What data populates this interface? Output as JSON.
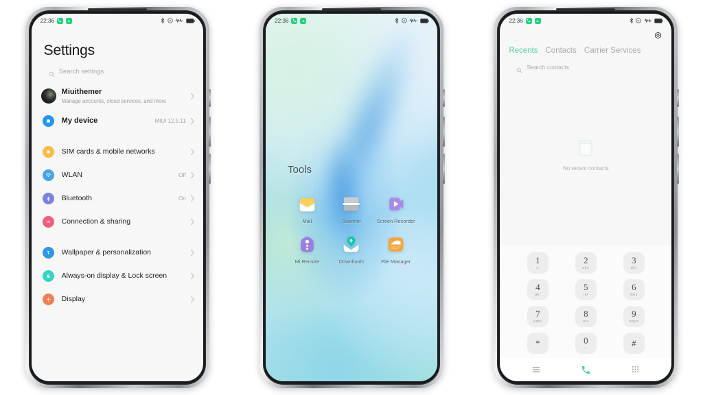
{
  "statusbar": {
    "time": "22:36",
    "left_icons": [
      "phone-badge-icon",
      "download-badge-icon"
    ],
    "right_icons": [
      "bluetooth-icon",
      "dnd-icon",
      "signal-wave-icon",
      "battery-icon"
    ]
  },
  "phone1": {
    "app": "Settings",
    "title": "Settings",
    "search_placeholder": "Search settings",
    "groups": [
      {
        "items": [
          {
            "icon": "account-avatar",
            "label": "Miuithemer",
            "sub": "Manage accounts, cloud services, and more",
            "value": "",
            "color": "#171a18",
            "bold": true
          },
          {
            "icon": "device-icon",
            "label": "My device",
            "sub": "",
            "value": "MIUI 12.5.11",
            "color": "#2196f3",
            "bold": true
          }
        ]
      },
      {
        "items": [
          {
            "icon": "sim-card-icon",
            "label": "SIM cards & mobile networks",
            "sub": "",
            "value": "",
            "color": "#f5bd42",
            "bold": false
          },
          {
            "icon": "wifi-icon",
            "label": "WLAN",
            "sub": "",
            "value": "Off",
            "color": "#4aa3e8",
            "bold": false
          },
          {
            "icon": "bluetooth-icon",
            "label": "Bluetooth",
            "sub": "",
            "value": "On",
            "color": "#7b82e0",
            "bold": false
          },
          {
            "icon": "connection-sharing-icon",
            "label": "Connection & sharing",
            "sub": "",
            "value": "",
            "color": "#ef5f7e",
            "bold": false
          }
        ]
      },
      {
        "items": [
          {
            "icon": "wallpaper-icon",
            "label": "Wallpaper & personalization",
            "sub": "",
            "value": "",
            "color": "#2f97e8",
            "bold": false
          },
          {
            "icon": "lock-icon",
            "label": "Always-on display & Lock screen",
            "sub": "",
            "value": "",
            "color": "#3ad3c2",
            "bold": false
          },
          {
            "icon": "display-icon",
            "label": "Display",
            "sub": "",
            "value": "",
            "color": "#ef8055",
            "bold": false
          }
        ]
      }
    ]
  },
  "phone2": {
    "app": "Home screen folder",
    "folder_title": "Tools",
    "apps": [
      {
        "name": "Mail",
        "icon": "mail-icon"
      },
      {
        "name": "Scanner",
        "icon": "scanner-icon"
      },
      {
        "name": "Screen Recorder",
        "icon": "screen-recorder-icon"
      },
      {
        "name": "Mi Remote",
        "icon": "mi-remote-icon"
      },
      {
        "name": "Downloads",
        "icon": "downloads-icon"
      },
      {
        "name": "File Manager",
        "icon": "file-manager-icon"
      }
    ]
  },
  "phone3": {
    "app": "Phone",
    "settings_icon": "gear-icon",
    "tabs": [
      {
        "label": "Recents",
        "active": true
      },
      {
        "label": "Contacts",
        "active": false
      },
      {
        "label": "Carrier Services",
        "active": false
      }
    ],
    "search_placeholder": "Search contacts",
    "empty_state": {
      "icon": "no-contacts-icon",
      "text": "No recent contacts"
    },
    "keypad": [
      {
        "num": "1",
        "sub": "∞"
      },
      {
        "num": "2",
        "sub": "abc"
      },
      {
        "num": "3",
        "sub": "def"
      },
      {
        "num": "4",
        "sub": "ghi"
      },
      {
        "num": "5",
        "sub": "jkl"
      },
      {
        "num": "6",
        "sub": "mno"
      },
      {
        "num": "7",
        "sub": "pqrs"
      },
      {
        "num": "8",
        "sub": "tuv"
      },
      {
        "num": "9",
        "sub": "wxyz"
      },
      {
        "num": "*",
        "sub": ""
      },
      {
        "num": "0",
        "sub": "+"
      },
      {
        "num": "#",
        "sub": ""
      }
    ],
    "bottom_bar": [
      {
        "icon": "menu-icon"
      },
      {
        "icon": "call-icon"
      },
      {
        "icon": "dialpad-icon"
      }
    ]
  },
  "colors": {
    "accent_green": "#5ecfa1",
    "call_green": "#4ecfa3",
    "screen_bg": "#f7f7f7",
    "text_primary": "#1b1c1e",
    "text_muted": "#a8a9ac"
  }
}
